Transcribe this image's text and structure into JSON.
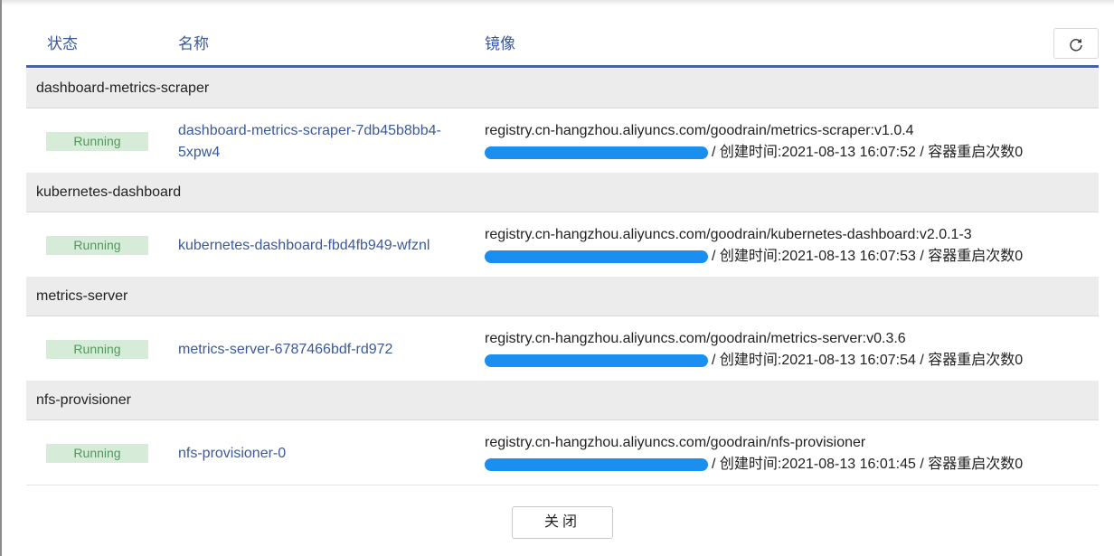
{
  "table": {
    "headers": {
      "status": "状态",
      "name": "名称",
      "image": "镜像"
    },
    "groups": [
      {
        "name": "dashboard-metrics-scraper",
        "pod": {
          "status": "Running",
          "name": "dashboard-metrics-scraper-7db45b8bb4-5xpw4",
          "image": "registry.cn-hangzhou.aliyuncs.com/goodrain/metrics-scraper:v1.0.4",
          "created": "/ 创建时间:2021-08-13 16:07:52 /  容器重启次数0"
        }
      },
      {
        "name": "kubernetes-dashboard",
        "pod": {
          "status": "Running",
          "name": "kubernetes-dashboard-fbd4fb949-wfznl",
          "image": "registry.cn-hangzhou.aliyuncs.com/goodrain/kubernetes-dashboard:v2.0.1-3",
          "created": "/ 创建时间:2021-08-13 16:07:53 /  容器重启次数0"
        }
      },
      {
        "name": "metrics-server",
        "pod": {
          "status": "Running",
          "name": "metrics-server-6787466bdf-rd972",
          "image": "registry.cn-hangzhou.aliyuncs.com/goodrain/metrics-server:v0.3.6",
          "created": "/ 创建时间:2021-08-13 16:07:54 /  容器重启次数0"
        }
      },
      {
        "name": "nfs-provisioner",
        "pod": {
          "status": "Running",
          "name": "nfs-provisioner-0",
          "image": "registry.cn-hangzhou.aliyuncs.com/goodrain/nfs-provisioner",
          "created": "/ 创建时间:2021-08-13 16:01:45 /  容器重启次数0"
        }
      }
    ]
  },
  "icons": {
    "refresh": "refresh-icon"
  },
  "footer": {
    "close_label": "关闭"
  },
  "colors": {
    "accent": "#4a5fa8",
    "link": "#3b5998",
    "running_bg": "#d6ecd9",
    "running_text": "#4f9a5a",
    "redaction": "#1a8ff0"
  }
}
